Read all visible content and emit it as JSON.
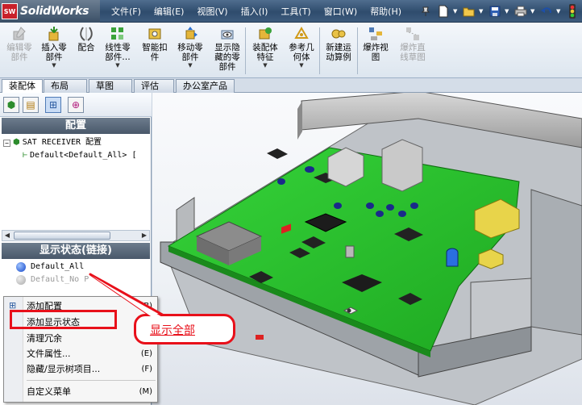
{
  "app": {
    "logo_badge": "SW",
    "name": "SolidWorks"
  },
  "menu": [
    "文件(F)",
    "编辑(E)",
    "视图(V)",
    "插入(I)",
    "工具(T)",
    "窗口(W)",
    "帮助(H)"
  ],
  "toolbar_icons": [
    "pin-icon",
    "new-document-icon",
    "open-folder-icon",
    "save-icon",
    "print-icon",
    "undo-icon",
    "traffic-light-icon"
  ],
  "ribbon": {
    "commands": [
      {
        "label": "编辑零\n部件",
        "disabled": true,
        "icon": "edit-part-icon"
      },
      {
        "label": "插入零\n部件",
        "disabled": false,
        "icon": "insert-component-icon"
      },
      {
        "label": "配合",
        "disabled": false,
        "icon": "mate-icon"
      },
      {
        "label": "线性零\n部件…",
        "disabled": false,
        "icon": "linear-pattern-icon"
      },
      {
        "label": "智能扣\n件",
        "disabled": false,
        "icon": "smart-fastener-icon"
      },
      {
        "label": "移动零\n部件",
        "disabled": false,
        "icon": "move-component-icon"
      },
      {
        "label": "显示隐\n藏的零\n部件",
        "disabled": false,
        "icon": "show-hidden-icon"
      },
      {
        "label": "装配体\n特征",
        "disabled": false,
        "icon": "assembly-feature-icon"
      },
      {
        "label": "参考几\n何体",
        "disabled": false,
        "icon": "reference-geometry-icon"
      },
      {
        "label": "新建运\n动算例",
        "disabled": false,
        "icon": "motion-study-icon"
      },
      {
        "label": "爆炸视\n图",
        "disabled": false,
        "icon": "explode-view-icon"
      },
      {
        "label": "爆炸直\n线草图",
        "disabled": true,
        "icon": "explode-line-icon"
      }
    ]
  },
  "tabs": [
    "装配体",
    "布局",
    "草图",
    "评估",
    "办公室产品"
  ],
  "config_panel": {
    "header": "配置",
    "root_label": "SAT RECEIVER 配置",
    "child_label": "Default<Default_All> [",
    "display_state_header": "显示状态(链接)",
    "display_states": [
      "Default_All",
      "Default_No P"
    ]
  },
  "context_menu": {
    "items": [
      {
        "label": "添加配置",
        "key": "(B)"
      },
      {
        "label": "添加显示状态",
        "key": "(C)"
      },
      {
        "label": "清理冗余",
        "key": ""
      },
      {
        "label": "文件属性...",
        "key": "(E)"
      },
      {
        "label": "隐藏/显示树项目...",
        "key": "(F)"
      },
      {
        "label": "自定义菜单",
        "key": "(M)"
      }
    ]
  },
  "callout": {
    "text": "显示全部"
  },
  "colors": {
    "highlight": "#e8101a",
    "pcb": "#27c42a"
  }
}
